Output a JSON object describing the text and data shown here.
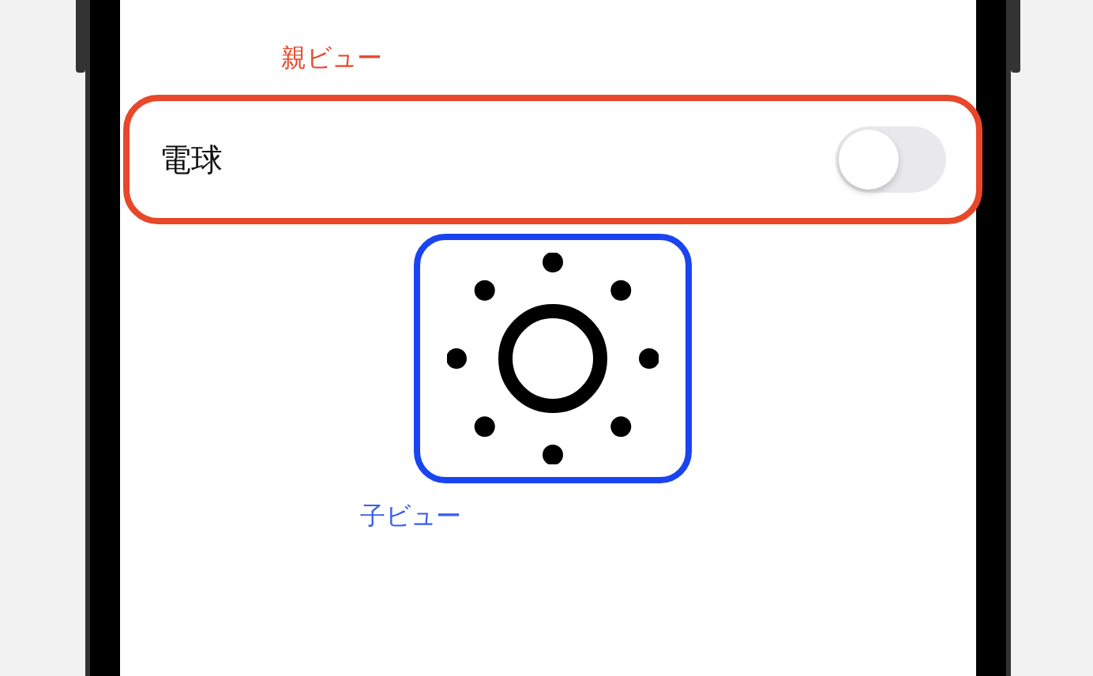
{
  "parent_view": {
    "label": "親ビュー",
    "row": {
      "title": "電球",
      "toggle": {
        "on": false
      }
    }
  },
  "child_view": {
    "label": "子ビュー"
  }
}
